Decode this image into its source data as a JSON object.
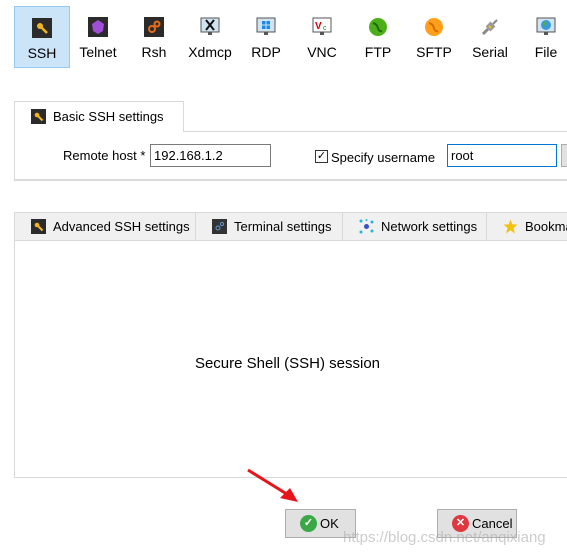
{
  "toolbar": {
    "items": [
      {
        "label": "SSH",
        "icon": "key-icon",
        "selected": true
      },
      {
        "label": "Telnet",
        "icon": "telnet-gem-icon"
      },
      {
        "label": "Rsh",
        "icon": "rsh-gears-icon"
      },
      {
        "label": "Xdmcp",
        "icon": "xdmcp-monitor-icon"
      },
      {
        "label": "RDP",
        "icon": "rdp-monitor-icon"
      },
      {
        "label": "VNC",
        "icon": "vnc-monitor-icon"
      },
      {
        "label": "FTP",
        "icon": "ftp-globe-icon"
      },
      {
        "label": "SFTP",
        "icon": "sftp-globe-icon"
      },
      {
        "label": "Serial",
        "icon": "serial-plug-icon"
      },
      {
        "label": "File",
        "icon": "file-monitor-icon"
      }
    ]
  },
  "basic": {
    "tab_label": "Basic SSH settings",
    "remote_host_label": "Remote host *",
    "remote_host_value": "192.168.1.2",
    "specify_username_label": "Specify username",
    "specify_username_checked": true,
    "username_value": "root"
  },
  "advanced_tabs": [
    {
      "label": "Advanced SSH settings",
      "icon": "key-icon"
    },
    {
      "label": "Terminal settings",
      "icon": "terminal-gears-icon"
    },
    {
      "label": "Network settings",
      "icon": "network-icon"
    },
    {
      "label": "Bookmark settings",
      "icon": "star-icon"
    }
  ],
  "panel_text": "Secure Shell (SSH) session",
  "buttons": {
    "ok": "OK",
    "cancel": "Cancel"
  },
  "watermark": "https://blog.csdn.net/anqixiang",
  "colors": {
    "selected_bg": "#cce4f7",
    "ok_green": "#3aa847",
    "cancel_red": "#e0383e",
    "arrow": "#e8141c"
  }
}
